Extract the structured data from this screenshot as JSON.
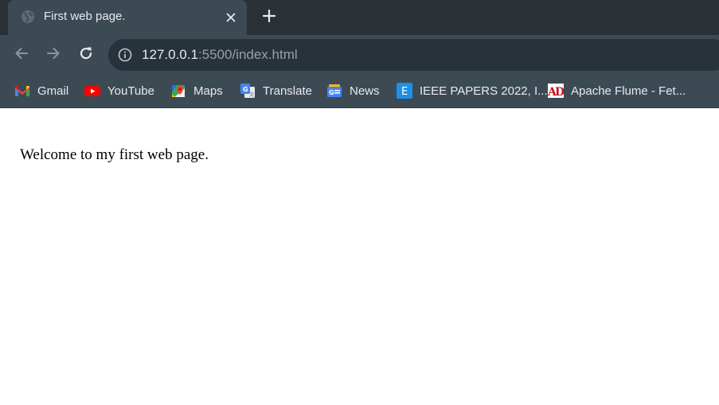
{
  "tab": {
    "title": "First web page."
  },
  "address_bar": {
    "host": "127.0.0.1",
    "rest": ":5500/index.html"
  },
  "bookmarks": [
    {
      "label": "Gmail",
      "icon": "gmail-icon"
    },
    {
      "label": "YouTube",
      "icon": "youtube-icon"
    },
    {
      "label": "Maps",
      "icon": "maps-icon"
    },
    {
      "label": "Translate",
      "icon": "translate-icon"
    },
    {
      "label": "News",
      "icon": "news-icon"
    },
    {
      "label": "IEEE PAPERS 2022, I...",
      "icon": "ieee-e-icon"
    },
    {
      "label": "Apache Flume - Fet...",
      "icon": "ad-icon"
    }
  ],
  "page": {
    "text": "Welcome to my first web page."
  },
  "colors": {
    "tab_strip": "#2a3035",
    "toolbar": "#3c4a54",
    "omnibox": "#27323a",
    "text_light": "#e8eaed",
    "text_dim": "#9aa0a6",
    "page_background": "#ffffff"
  }
}
